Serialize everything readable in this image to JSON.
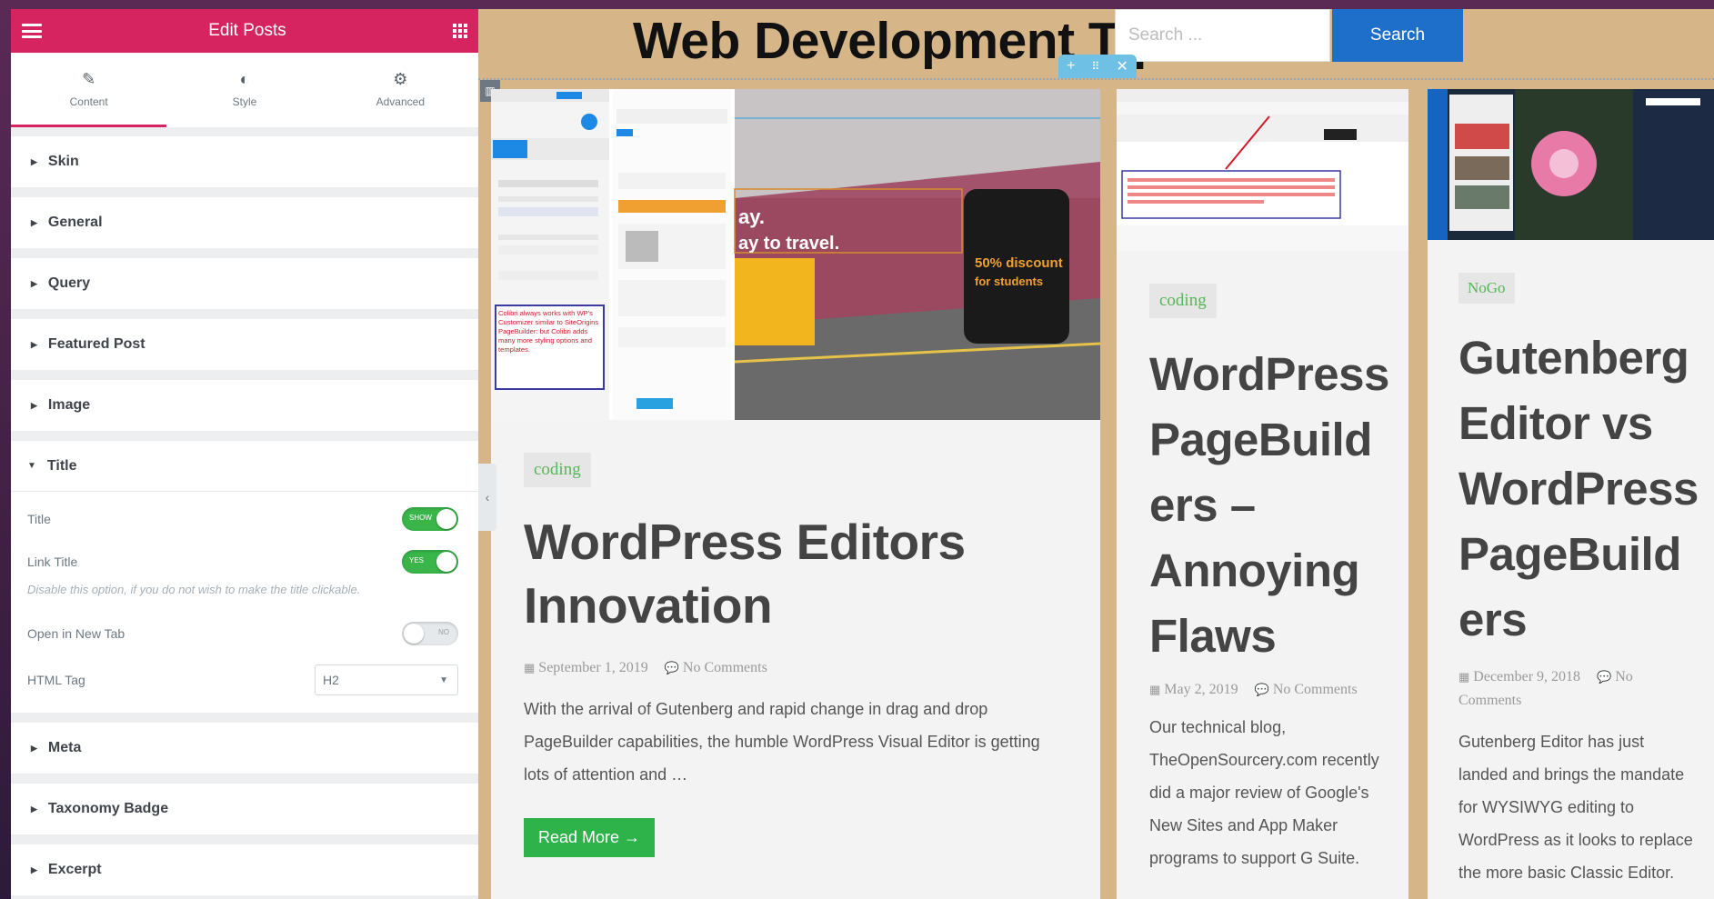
{
  "panel": {
    "title": "Edit Posts",
    "tabs": [
      {
        "label": "Content",
        "icon": "pencil-icon"
      },
      {
        "label": "Style",
        "icon": "contrast-icon"
      },
      {
        "label": "Advanced",
        "icon": "gear-icon"
      }
    ],
    "sections_before": [
      "Skin",
      "General",
      "Query",
      "Featured Post",
      "Image"
    ],
    "title_section": {
      "label": "Title",
      "title_label": "Title",
      "title_toggle": "SHOW",
      "link_title_label": "Link Title",
      "link_title_toggle": "YES",
      "hint": "Disable this option, if you do not wish to make the title clickable.",
      "new_tab_label": "Open in New Tab",
      "new_tab_toggle": "NO",
      "html_tag_label": "HTML Tag",
      "html_tag_value": "H2"
    },
    "sections_after": [
      "Meta",
      "Taxonomy Badge",
      "Excerpt"
    ]
  },
  "site": {
    "title": "Web Development Tips",
    "search_placeholder": "Search ...",
    "search_button": "Search"
  },
  "posts": [
    {
      "badge": "coding",
      "title": "WordPress Editors Innovation",
      "date": "September 1, 2019",
      "comments": "No Comments",
      "excerpt": "With the arrival of Gutenberg and rapid change in drag and drop PageBuilder capabilities, the humble WordPress Visual Editor is getting lots of attention and …",
      "read_more": "Read More →",
      "thumb_note": "Colibri always works with WP's Customizer similar to SiteOrigins PageBuilder: but Colibri adds many more styling options and templates.",
      "thumb_promo1": "ay.",
      "thumb_promo2": "ay to travel.",
      "thumb_discount": "50% discount",
      "thumb_discount2": "for students"
    },
    {
      "badge": "coding",
      "title": "WordPress PageBuild ers – Annoying Flaws",
      "date": "May 2, 2019",
      "comments": "No Comments",
      "excerpt": "Our technical blog, TheOpenSourcery.com recently did a major review of Google's New Sites and App Maker programs to support G Suite."
    },
    {
      "badge": "NoGo",
      "title": "Gutenberg Editor vs WordPress PageBuild ers",
      "date": "December 9, 2018",
      "comments": "No Comments",
      "excerpt": "Gutenberg Editor has just landed and brings the mandate for WYSIWYG editing to WordPress as it looks to replace the more basic Classic Editor."
    }
  ],
  "colors": {
    "accent": "#d5245f",
    "preview_bg": "#d6b688",
    "search_btn": "#1e6fc9",
    "badge_text": "#57b55a",
    "read_more": "#2eb34a",
    "toggle_on": "#39b54a"
  }
}
